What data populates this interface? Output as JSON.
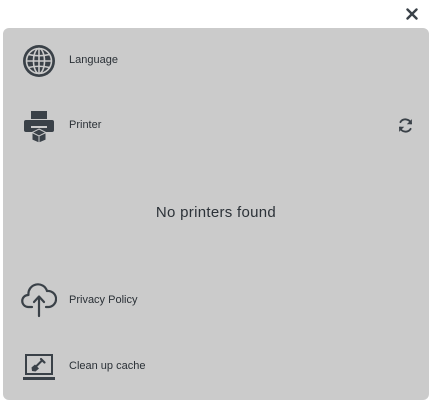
{
  "dialog": {
    "close_icon": "close-icon"
  },
  "menu": {
    "language": {
      "label": "Language",
      "icon": "globe-icon"
    },
    "printer": {
      "label": "Printer",
      "icon": "printer-icon",
      "refresh_icon": "refresh-icon"
    },
    "privacy": {
      "label": "Privacy Policy",
      "icon": "cloud-upload-icon"
    },
    "cache": {
      "label": "Clean up cache",
      "icon": "laptop-brush-icon"
    }
  },
  "printer_list": {
    "empty_message": "No printers found"
  },
  "colors": {
    "panel_bg": "#cbcbcb",
    "icon": "#3a4148",
    "text": "#2a3036"
  }
}
